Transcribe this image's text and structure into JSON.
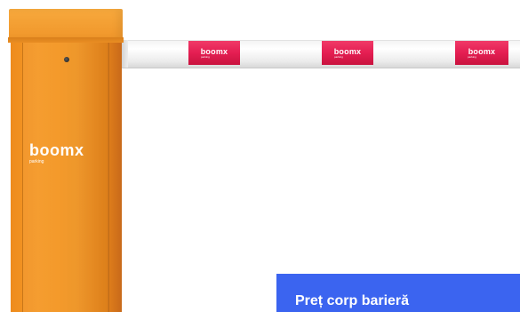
{
  "arm": {
    "band_logo": "boomx",
    "band_sub": "parking"
  },
  "cabinet": {
    "logo": "boomx",
    "logo_sub": "parking"
  },
  "banner": {
    "title": "Preț corp barieră"
  },
  "colors": {
    "cabinet_orange": "#f39a2c",
    "band_red": "#e41e52",
    "banner_blue": "#3b64f0",
    "arm_white": "#ffffff"
  }
}
